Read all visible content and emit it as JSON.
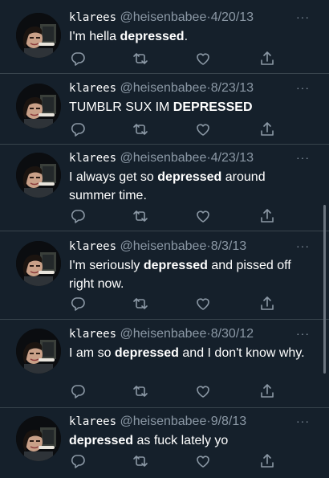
{
  "colors": {
    "background": "#15202b",
    "text": "#ffffff",
    "muted": "#8b98a5",
    "divider": "#38444d"
  },
  "icons": {
    "reply": "reply-icon",
    "retweet": "retweet-icon",
    "like": "like-icon",
    "share": "share-icon",
    "more": "more-icon"
  },
  "tweets": [
    {
      "display_name": "klarees",
      "handle": "@heisenbabee",
      "separator": "·",
      "date": "4/20/13",
      "more": "···",
      "text_before": "I'm hella ",
      "keyword": "depressed",
      "text_after": "."
    },
    {
      "display_name": "klarees",
      "handle": "@heisenbabee",
      "separator": "·",
      "date": "8/23/13",
      "more": "···",
      "text_before": "TUMBLR SUX IM ",
      "keyword": "DEPRESSED",
      "text_after": ""
    },
    {
      "display_name": "klarees",
      "handle": "@heisenbabee",
      "separator": "·",
      "date": "4/23/13",
      "more": "···",
      "text_before": "I always get so ",
      "keyword": "depressed",
      "text_after": " around summer time."
    },
    {
      "display_name": "klarees",
      "handle": "@heisenbabee",
      "separator": "·",
      "date": "8/3/13",
      "more": "···",
      "text_before": "I'm seriously ",
      "keyword": "depressed",
      "text_after": " and pissed off right now."
    },
    {
      "display_name": "klarees",
      "handle": "@heisenbabee",
      "separator": "·",
      "date": "8/30/12",
      "more": "···",
      "text_before": "I am so ",
      "keyword": "depressed",
      "text_after": " and I don't know why."
    },
    {
      "display_name": "klarees",
      "handle": "@heisenbabee",
      "separator": "·",
      "date": "9/8/13",
      "more": "···",
      "text_before": "",
      "keyword": "depressed",
      "text_after": " as fuck lately yo"
    }
  ]
}
